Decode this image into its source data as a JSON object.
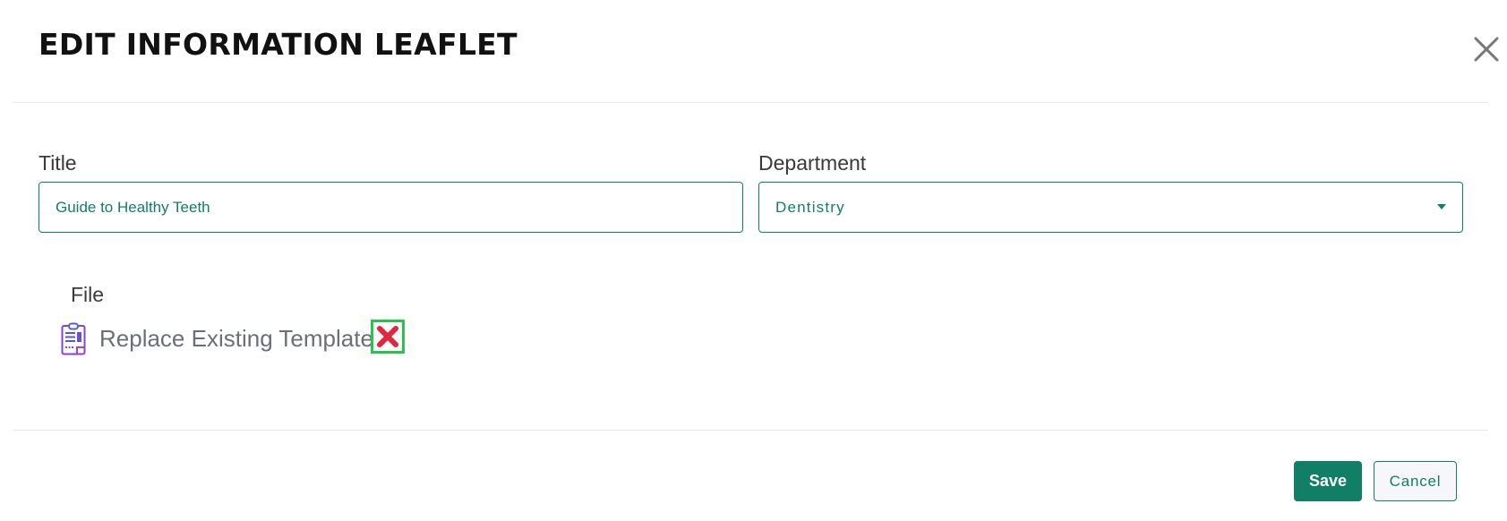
{
  "modal": {
    "title": "EDIT INFORMATION LEAFLET",
    "close_icon": "close-icon"
  },
  "form": {
    "title_label": "Title",
    "title_value": "Guide to Healthy Teeth",
    "department_label": "Department",
    "department_value": "Dentistry",
    "file_label": "File",
    "file_name": "Replace Existing Template",
    "file_icon": "document-icon",
    "remove_icon": "remove-x-icon"
  },
  "footer": {
    "save_label": "Save",
    "cancel_label": "Cancel"
  },
  "colors": {
    "accent": "#117e66",
    "remove_red": "#e0273d",
    "highlight_green": "#27c54a",
    "file_icon": "#8a3fd6"
  }
}
